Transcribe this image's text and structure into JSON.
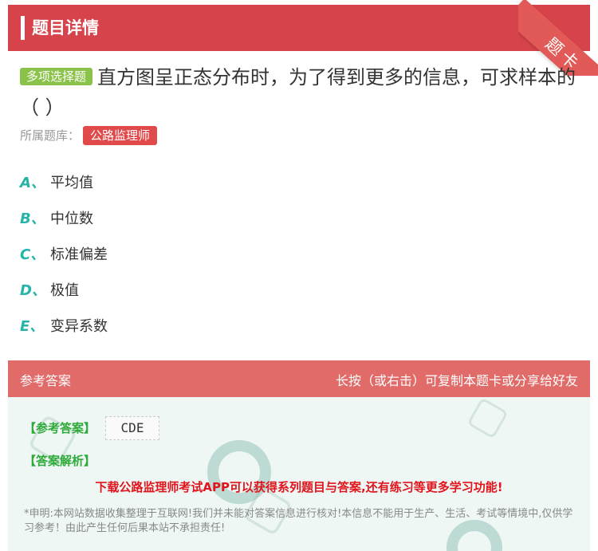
{
  "header": {
    "title": "题目详情",
    "ribbon": "题卡"
  },
  "question": {
    "type_tag": "多项选择题",
    "text": "直方图呈正态分布时，为了得到更多的信息，可求样本的（ ）"
  },
  "bank": {
    "label": "所属题库：",
    "name": "公路监理师"
  },
  "options": [
    {
      "letter": "A、",
      "text": "平均值"
    },
    {
      "letter": "B、",
      "text": "中位数"
    },
    {
      "letter": "C、",
      "text": "标准偏差"
    },
    {
      "letter": "D、",
      "text": "极值"
    },
    {
      "letter": "E、",
      "text": "变异系数"
    }
  ],
  "answer": {
    "header_left": "参考答案",
    "header_right": "长按（或右击）可复制本题卡或分享给好友",
    "ref_label": "【参考答案】",
    "ref_value": "CDE",
    "analysis_label": "【答案解析】",
    "promo": "下载公路监理师考试APP可以获得系列题目与答案,还有练习等更多学习功能!",
    "declaration": "*申明:本网站数据收集整理于互联网!我们并未能对答案信息进行核对!本信息不能用于生产、生活、考试等情境中,仅供学习参考！由此产生任何后果本站不承担责任!"
  },
  "colors": {
    "header": "#d7434b",
    "accent_green": "#8bc34a",
    "letter": "#26b3a8",
    "bank_tag": "#e04a4a"
  }
}
